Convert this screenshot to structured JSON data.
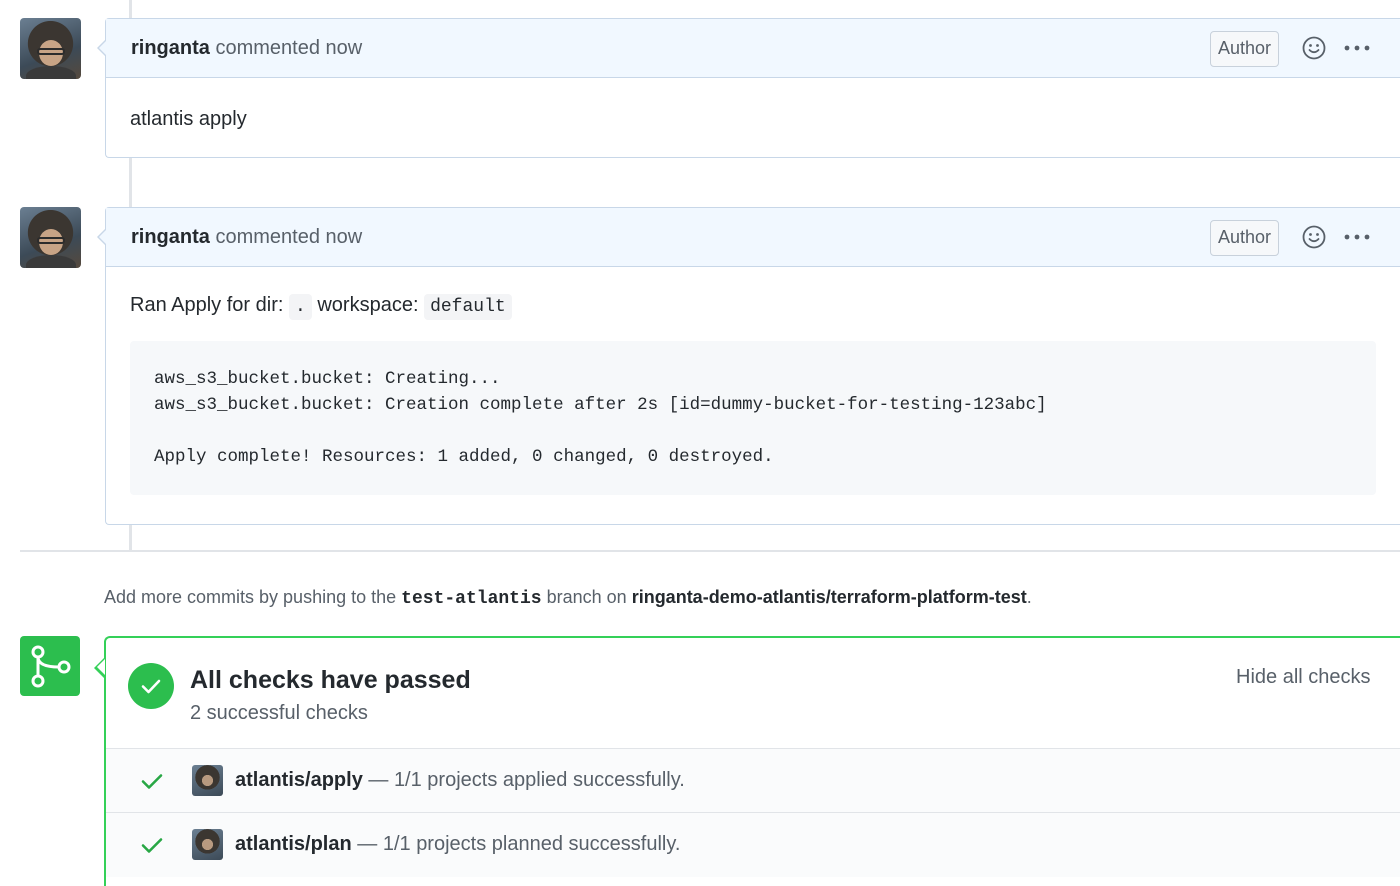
{
  "comments": [
    {
      "author": "ringanta",
      "action": "commented now",
      "badge": "Author",
      "body": "atlantis apply"
    },
    {
      "author": "ringanta",
      "action": "commented now",
      "badge": "Author",
      "body_prefix": "Ran Apply for dir:",
      "dir": ".",
      "workspace_label": "workspace:",
      "workspace": "default",
      "code_block": "aws_s3_bucket.bucket: Creating...\naws_s3_bucket.bucket: Creation complete after 2s [id=dummy-bucket-for-testing-123abc]\n\nApply complete! Resources: 1 added, 0 changed, 0 destroyed."
    }
  ],
  "push_note": {
    "prefix": "Add more commits by pushing to the",
    "branch": "test-atlantis",
    "middle": "branch on",
    "repo": "ringanta-demo-atlantis/terraform-platform-test",
    "suffix": "."
  },
  "checks": {
    "title": "All checks have passed",
    "subtitle": "2 successful checks",
    "hide_label": "Hide all checks",
    "items": [
      {
        "context": "atlantis/apply",
        "separator": "—",
        "description": "1/1 projects applied successfully."
      },
      {
        "context": "atlantis/plan",
        "separator": "—",
        "description": "1/1 projects planned successfully."
      }
    ]
  },
  "colors": {
    "success": "#2cbe4e",
    "header_bg": "#f1f8ff",
    "border": "#c8d7e8"
  },
  "icons": [
    "emoji-reaction-icon",
    "kebab-menu-icon",
    "git-merge-icon",
    "check-icon"
  ]
}
